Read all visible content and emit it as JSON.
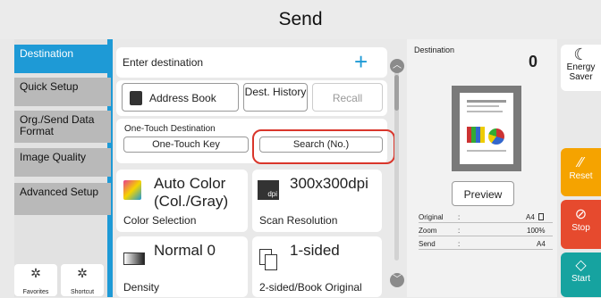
{
  "title": "Send",
  "sidebar": {
    "items": [
      {
        "label": "Destination"
      },
      {
        "label": "Quick Setup"
      },
      {
        "label": "Org./Send Data Format"
      },
      {
        "label": "Image Quality"
      },
      {
        "label": "Advanced Setup"
      }
    ],
    "favorites_label": "Favorites",
    "shortcut_label": "Shortcut"
  },
  "destination_bar": {
    "placeholder": "Enter destination"
  },
  "buttons": {
    "address_book": "Address Book",
    "dest_history": "Dest. History",
    "recall": "Recall"
  },
  "one_touch": {
    "title": "One-Touch Destination",
    "key_label": "One-Touch Key",
    "search_label": "Search (No.)"
  },
  "settings": {
    "color": {
      "value": "Auto Color (Col./Gray)",
      "label": "Color Selection"
    },
    "resolution": {
      "value": "300x300dpi",
      "label": "Scan Resolution"
    },
    "density": {
      "value": "Normal 0",
      "label": "Density"
    },
    "duplex": {
      "value": "1-sided",
      "label": "2-sided/Book Original"
    }
  },
  "preview_panel": {
    "destination_label": "Destination",
    "destination_count": "0",
    "preview_button": "Preview",
    "rows": [
      {
        "key": "Original",
        "sep": ":",
        "value": "A4"
      },
      {
        "key": "Zoom",
        "sep": ":",
        "value": "100%"
      },
      {
        "key": "Send",
        "sep": ":",
        "value": "A4"
      }
    ]
  },
  "right_buttons": {
    "energy_saver": "Energy Saver",
    "reset": "Reset",
    "stop": "Stop",
    "start": "Start"
  },
  "colors": {
    "accent": "#1e9ad6",
    "reset": "#f5a300",
    "stop": "#e64a2e",
    "start": "#16a3a0",
    "highlight_ring": "#d9362b"
  },
  "icons": {
    "add": "plus-icon",
    "address_book": "address-book-icon",
    "color": "color-selection-icon",
    "resolution": "dpi-icon",
    "density": "density-icon",
    "duplex": "duplex-icon",
    "energy": "moon-icon",
    "reset": "reset-icon",
    "stop": "stop-icon",
    "start": "start-icon"
  }
}
